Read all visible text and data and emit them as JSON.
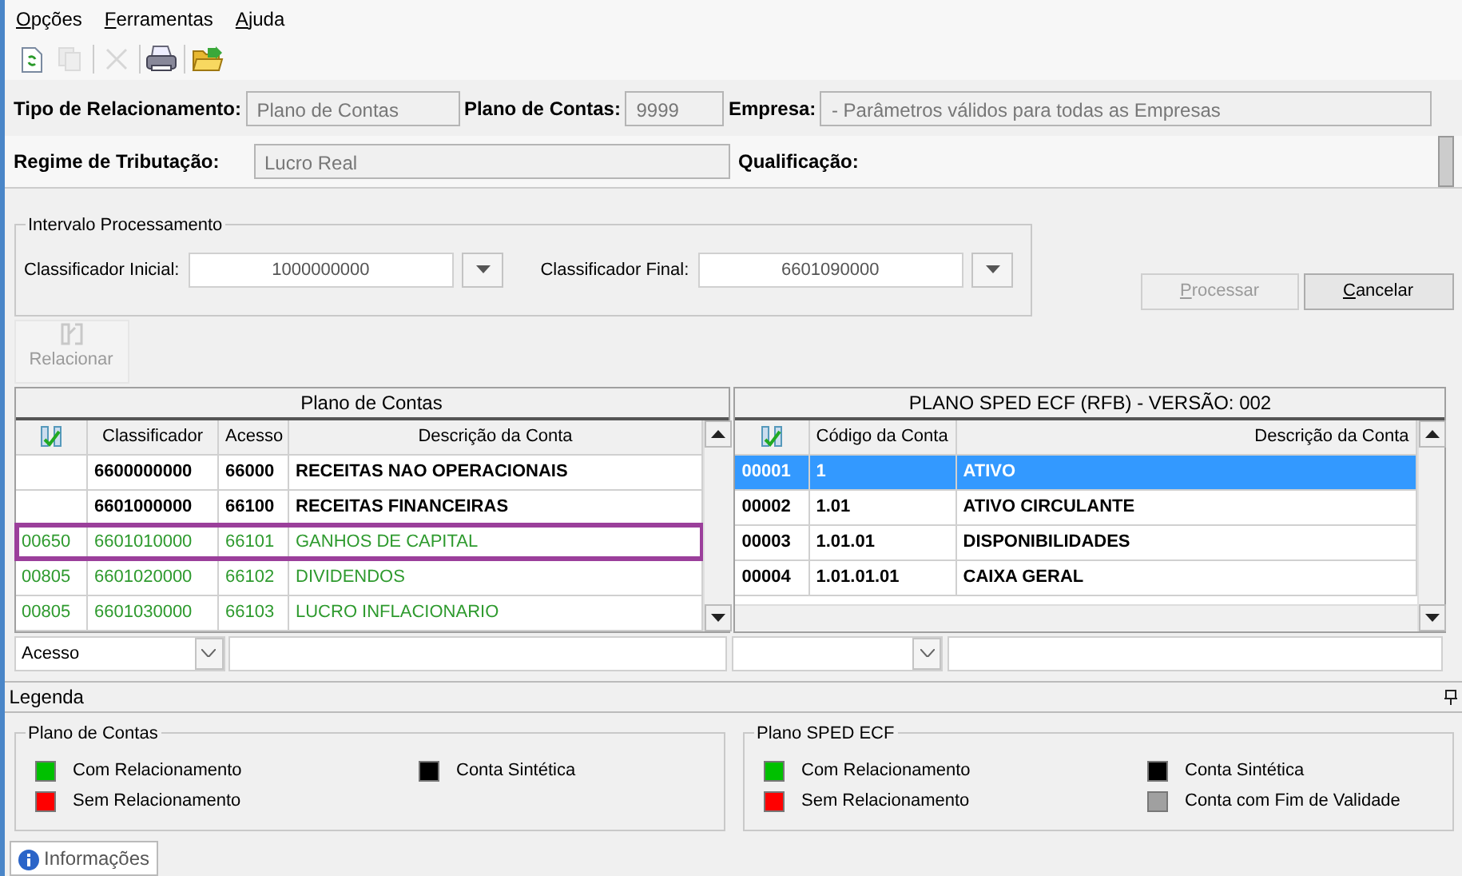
{
  "menu": [
    {
      "label": "Opções"
    },
    {
      "label": "Ferramentas"
    },
    {
      "label": "Ajuda"
    }
  ],
  "toolbar": [
    {
      "kind": "refresh",
      "disabled": false
    },
    {
      "kind": "copy",
      "disabled": true
    },
    {
      "kind": "delete",
      "disabled": true
    },
    {
      "kind": "print",
      "disabled": false
    },
    {
      "kind": "open",
      "disabled": false
    }
  ],
  "header": {
    "tipo_label": "Tipo de Relacionamento:",
    "tipo_value": "Plano de Contas",
    "plano_label": "Plano de Contas:",
    "plano_value": "9999",
    "empresa_label": "Empresa:",
    "empresa_value": "- Parâmetros válidos para todas as Empresas",
    "regime_label": "Regime de Tributação:",
    "regime_value": "Lucro Real",
    "qualificacao_label": "Qualificação:"
  },
  "interval": {
    "title": "Intervalo Processamento",
    "initial_label": "Classificador Inicial:",
    "initial_value": "1000000000",
    "final_label": "Classificador Final:",
    "final_value": "6601090000"
  },
  "buttons": [
    {
      "label": "Processar",
      "disabled": true
    },
    {
      "label": "Cancelar",
      "disabled": false
    }
  ],
  "relate_button": {
    "label": "Relacionar",
    "disabled": true
  },
  "left_grid": {
    "title": "Plano de Contas",
    "columns": [
      "Classificador",
      "Acesso",
      "Descrição da Conta"
    ],
    "rows": [
      {
        "kind": "synthetic",
        "highlighted": false,
        "classificador": "6600000000",
        "acesso": "66000",
        "descricao": "RECEITAS NAO OPERACIONAIS"
      },
      {
        "kind": "synthetic",
        "highlighted": false,
        "classificador": "6601000000",
        "acesso": "66100",
        "descricao": "RECEITAS FINANCEIRAS"
      },
      {
        "kind": "related",
        "highlighted": true,
        "code": "00650",
        "classificador": "6601010000",
        "acesso": "66101",
        "descricao": "GANHOS DE CAPITAL"
      },
      {
        "kind": "related",
        "highlighted": false,
        "code": "00805",
        "classificador": "6601020000",
        "acesso": "66102",
        "descricao": "DIVIDENDOS"
      },
      {
        "kind": "related",
        "highlighted": false,
        "code": "00805",
        "classificador": "6601030000",
        "acesso": "66103",
        "descricao": "LUCRO INFLACIONARIO"
      }
    ],
    "filter_value": "Acesso"
  },
  "right_grid": {
    "title": "PLANO SPED ECF (RFB) - VERSÃO: 002",
    "columns": [
      "Código da Conta",
      "Descrição da Conta"
    ],
    "rows": [
      {
        "selected": true,
        "code": "00001",
        "codigo": "1",
        "descricao": "ATIVO"
      },
      {
        "selected": false,
        "code": "00002",
        "codigo": "1.01",
        "descricao": "ATIVO CIRCULANTE"
      },
      {
        "selected": false,
        "code": "00003",
        "codigo": "1.01.01",
        "descricao": "DISPONIBILIDADES"
      },
      {
        "selected": false,
        "code": "00004",
        "codigo": "1.01.01.01",
        "descricao": "CAIXA GERAL"
      }
    ]
  },
  "legend": {
    "title": "Legenda",
    "groups": [
      {
        "title": "Plano de Contas",
        "items": [
          {
            "label": "Com Relacionamento",
            "color": "#00c000"
          },
          {
            "label": "Sem Relacionamento",
            "color": "#ff0000"
          },
          {
            "label": "Conta Sintética",
            "color": "#000000"
          }
        ]
      },
      {
        "title": "Plano SPED ECF",
        "items": [
          {
            "label": "Com Relacionamento",
            "color": "#00c000"
          },
          {
            "label": "Sem Relacionamento",
            "color": "#ff0000"
          },
          {
            "label": "Conta Sintética",
            "color": "#000000"
          },
          {
            "label": "Conta com Fim de Validade",
            "color": "#a0a0a0"
          }
        ]
      }
    ]
  },
  "bottom_tab": {
    "label": "Informações"
  }
}
